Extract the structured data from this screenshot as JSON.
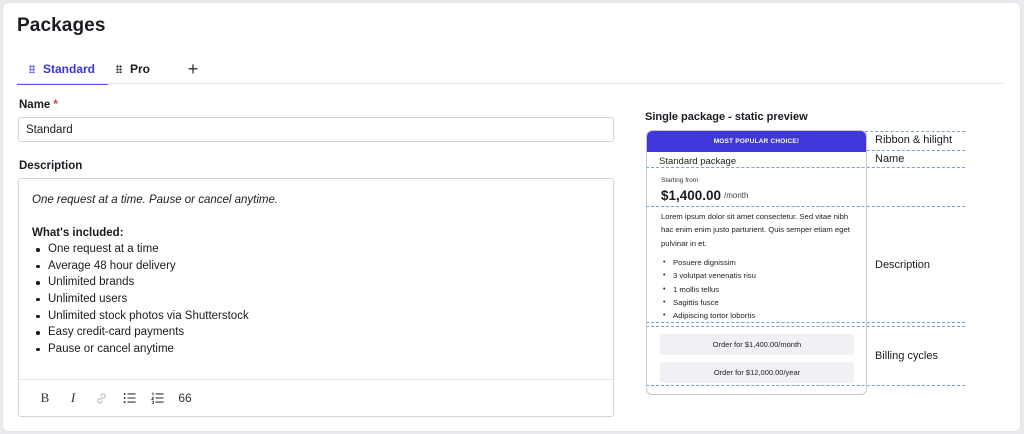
{
  "page": {
    "title": "Packages"
  },
  "tabs": [
    {
      "label": "Standard",
      "active": true
    },
    {
      "label": "Pro",
      "active": false
    }
  ],
  "add_tab_symbol": "+",
  "form": {
    "name_label": "Name",
    "required_mark": "*",
    "name_value": "Standard",
    "description_label": "Description",
    "description": {
      "intro": "One request at a time. Pause or cancel anytime.",
      "heading": "What's included:",
      "items": [
        "One request at a time",
        "Average 48 hour delivery",
        "Unlimited brands",
        "Unlimited users",
        "Unlimited stock photos via Shutterstock",
        "Easy credit-card payments",
        "Pause or cancel anytime"
      ]
    },
    "toolbar": {
      "bold": "B",
      "italic": "I",
      "link_icon": "link-icon",
      "bullet_list_icon": "bullet-list-icon",
      "numbered_list_icon": "numbered-list-icon",
      "quote": "66"
    }
  },
  "preview": {
    "title": "Single package - static preview",
    "ribbon": "MOST POPULAR CHOICE!",
    "package_name": "Standard package",
    "starting_from": "Starting from",
    "price": "$1,400.00",
    "per": "/month",
    "description": "Lorem ipsum dolor sit amet consectetur. Sed vitae nibh hac enim enim justo parturient. Quis semper etiam eget pulvinar in et.",
    "features": [
      "Posuere dignissim",
      "3 volutpat venenatis risu",
      "1  mollis tellus",
      "Sagittis fusce",
      " Adipiscing tortor lobortis"
    ],
    "order_buttons": [
      {
        "label": "Order for $1,400.00",
        "period": "/month"
      },
      {
        "label": "Order for $12,000.00",
        "period": "/year"
      }
    ],
    "side_labels": {
      "ribbon": "Ribbon & hilight",
      "name": "Name",
      "description": "Description",
      "billing": "Billing cycles"
    }
  },
  "colors": {
    "accent": "#3f37d9",
    "guide": "#6ea4dc",
    "required": "#e23b3b"
  }
}
